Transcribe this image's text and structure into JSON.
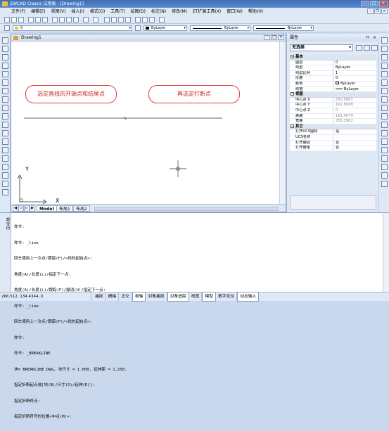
{
  "app": {
    "title": "ZWCAD Classic 试用版 - [Drawing1]"
  },
  "menu": [
    "文件(F)",
    "编辑(E)",
    "视图(V)",
    "插入(I)",
    "格式(O)",
    "工具(T)",
    "绘图(D)",
    "标注(N)",
    "修改(M)",
    "ET扩展工具(X)",
    "窗口(W)",
    "帮助(H)"
  ],
  "toolbar": {
    "layer_value": "0",
    "color_value": "ByLayer",
    "linetype_value": "ByLayer",
    "lineweight_value": "ByLayer"
  },
  "drawing": {
    "tab_title": "Drawing1",
    "tabs": [
      "Model",
      "布局1",
      "布局2"
    ],
    "callout_left": "选定直线的开端点和结尾点",
    "callout_right": "再选定打断点",
    "ucs_x": "X",
    "ucs_y": "Y"
  },
  "properties": {
    "header": "属性",
    "selection": "无选择",
    "groups": [
      {
        "name": "基本",
        "rows": [
          {
            "k": "图层",
            "v": "0"
          },
          {
            "k": "线型",
            "v": "ByLayer"
          },
          {
            "k": "线型比例",
            "v": "1"
          },
          {
            "k": "厚度",
            "v": "0"
          },
          {
            "k": "颜色",
            "v": "ByLayer"
          },
          {
            "k": "线宽",
            "v": "ByLayer"
          }
        ]
      },
      {
        "name": "视图",
        "rows": [
          {
            "k": "中心点 X",
            "v": "250.5801",
            "grey": true
          },
          {
            "k": "中心点 Y",
            "v": "162.8008",
            "grey": true
          },
          {
            "k": "中心点 Z",
            "v": "0",
            "grey": true
          },
          {
            "k": "高度",
            "v": "161.4679",
            "grey": true
          },
          {
            "k": "宽度",
            "v": "255.3902",
            "grey": true
          }
        ]
      },
      {
        "name": "其它",
        "rows": [
          {
            "k": "打开UCS图标",
            "v": "是"
          },
          {
            "k": "UCS名称",
            "v": ""
          },
          {
            "k": "打开捕捉",
            "v": "否"
          },
          {
            "k": "打开栅格",
            "v": "否"
          }
        ]
      }
    ]
  },
  "command": {
    "label": "命令行",
    "lines": [
      "命令:",
      "命令: _line",
      "回车使用上一次点/跟踪(F)/<线的起始点>:",
      "角度(A)/长度(L)/指定下一点:",
      "角度(A)/长度(L)/跟踪(F)/撤消(U)/指定下一点:",
      "命令: _line",
      "回车使用上一次点/跟踪(F)/<线的起始点>:",
      "命令:",
      "命令: _BREAKLINE",
      "块= BREAKLINE.DWG, 块尺寸 = 1.000, 延伸距 = 1.250.",
      "指定折断起点或[块(B)/尺寸(S)/延伸(E)]:",
      "指定折断终点:",
      "指定折断符号的位置<中点(M)>:"
    ]
  },
  "status": {
    "coords": "266.512,  134.4344,  0",
    "buttons": [
      "捕捉",
      "栅格",
      "正交",
      "极轴",
      "对象捕捉",
      "对象追踪",
      "线宽",
      "模型",
      "数字化仪",
      "动态输入"
    ]
  }
}
